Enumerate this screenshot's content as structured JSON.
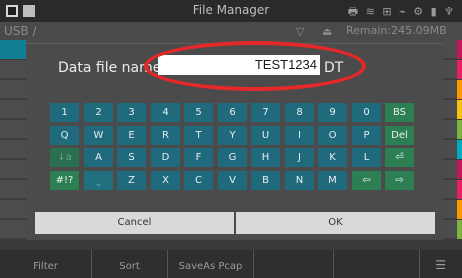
{
  "statusbar": {
    "title": "File Manager"
  },
  "pathbar": {
    "path": "USB /",
    "remain": "Remain:245.09MB"
  },
  "dialog": {
    "filename_label": "Data file name:",
    "filename_value": "TEST1234",
    "filename_ext": "DT",
    "cancel_label": "Cancel",
    "ok_label": "OK"
  },
  "keyboard": {
    "rows": [
      [
        {
          "label": "1"
        },
        {
          "label": "2"
        },
        {
          "label": "3"
        },
        {
          "label": "4"
        },
        {
          "label": "5"
        },
        {
          "label": "6"
        },
        {
          "label": "7"
        },
        {
          "label": "8"
        },
        {
          "label": "9"
        },
        {
          "label": "0"
        },
        {
          "label": "BS",
          "style": "green"
        }
      ],
      [
        {
          "label": "Q"
        },
        {
          "label": "W"
        },
        {
          "label": "E"
        },
        {
          "label": "R"
        },
        {
          "label": "T"
        },
        {
          "label": "Y"
        },
        {
          "label": "U"
        },
        {
          "label": "I"
        },
        {
          "label": "O"
        },
        {
          "label": "P"
        },
        {
          "label": "Del",
          "style": "green"
        }
      ],
      [
        {
          "label": "↓a",
          "style": "green-dim"
        },
        {
          "label": "A"
        },
        {
          "label": "S"
        },
        {
          "label": "D"
        },
        {
          "label": "F"
        },
        {
          "label": "G"
        },
        {
          "label": "H"
        },
        {
          "label": "J"
        },
        {
          "label": "K"
        },
        {
          "label": "L"
        },
        {
          "label": "⏎",
          "style": "green"
        }
      ],
      [
        {
          "label": "#!?",
          "style": "green"
        },
        {
          "label": "⎵",
          "style": "dim"
        },
        {
          "label": "Z"
        },
        {
          "label": "X"
        },
        {
          "label": "C"
        },
        {
          "label": "V"
        },
        {
          "label": "B"
        },
        {
          "label": "N"
        },
        {
          "label": "M"
        },
        {
          "label": "⇦",
          "style": "green"
        },
        {
          "label": "⇨",
          "style": "green"
        }
      ]
    ]
  },
  "softkeys": [
    "Filter",
    "Sort",
    "SaveAs Pcap",
    "",
    ""
  ],
  "colors": {
    "accent": "#127f96",
    "key": "#1f6b7d",
    "key_green": "#2c7f53",
    "highlight": "#e5282a",
    "stripes": [
      "#c2185b",
      "#e91e63",
      "#ff9800",
      "#f4c20d",
      "#7cb342",
      "#00acc1"
    ]
  }
}
